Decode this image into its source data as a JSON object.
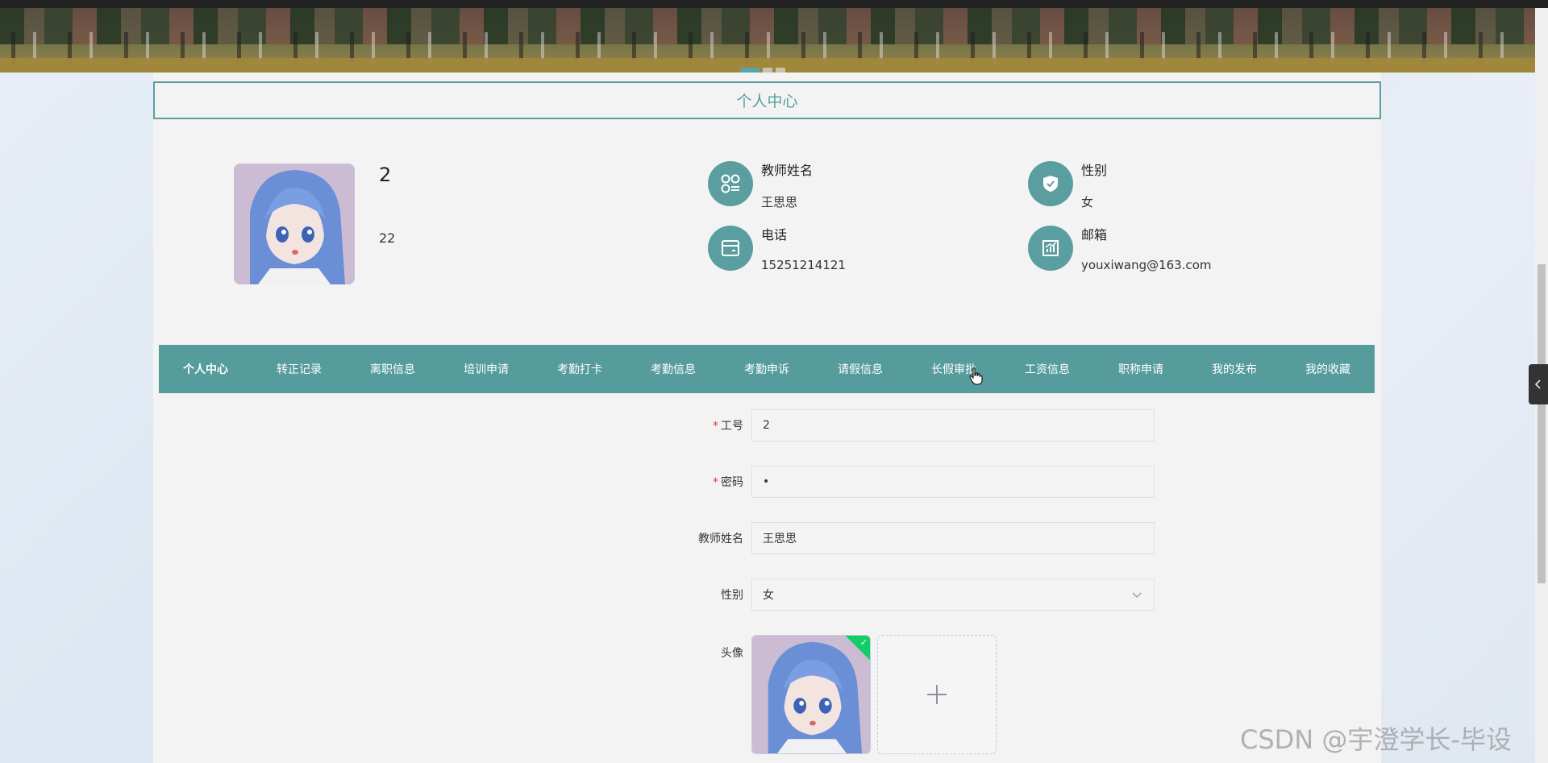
{
  "page_title": "个人中心",
  "profile": {
    "username": "2",
    "sub": "22",
    "fields": [
      {
        "label": "教师姓名",
        "value": "王思思",
        "icon": "grid-icon"
      },
      {
        "label": "性别",
        "value": "女",
        "icon": "shield-icon"
      },
      {
        "label": "电话",
        "value": "15251214121",
        "icon": "wallet-icon"
      },
      {
        "label": "邮箱",
        "value": "youxiwang@163.com",
        "icon": "chart-icon"
      }
    ]
  },
  "tabs": [
    "个人中心",
    "转正记录",
    "离职信息",
    "培训申请",
    "考勤打卡",
    "考勤信息",
    "考勤申诉",
    "请假信息",
    "长假审批",
    "工资信息",
    "职称申请",
    "我的发布",
    "我的收藏"
  ],
  "form": {
    "job_no": {
      "label": "工号",
      "value": "2"
    },
    "password": {
      "label": "密码",
      "value": "•"
    },
    "teacher_name": {
      "label": "教师姓名",
      "value": "王思思"
    },
    "gender": {
      "label": "性别",
      "value": "女"
    },
    "avatar": {
      "label": "头像"
    }
  },
  "watermark": "CSDN @宇澄学长-毕设",
  "colors": {
    "accent": "#5a9ea0",
    "tab_bg": "#569c9d",
    "success": "#13ce66"
  }
}
